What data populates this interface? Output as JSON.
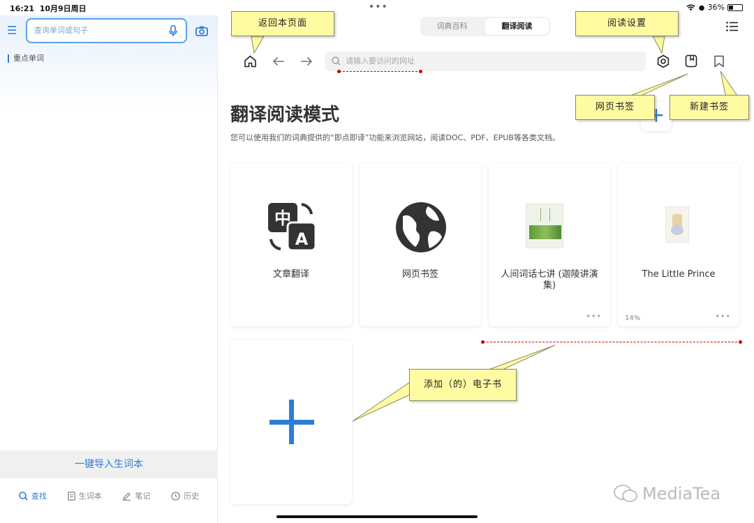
{
  "status": {
    "time": "16:21",
    "date": "10月9日周日",
    "battery": "36%",
    "battery_level": 0.36
  },
  "left": {
    "search_placeholder": "查询单词或句子",
    "section_label": "重点单词",
    "import_label": "一键导入生词本",
    "tabs": [
      {
        "label": "查找",
        "icon": "search-icon",
        "active": true
      },
      {
        "label": "生词本",
        "icon": "notebook-icon",
        "active": false
      },
      {
        "label": "笔记",
        "icon": "pen-icon",
        "active": false
      },
      {
        "label": "历史",
        "icon": "clock-icon",
        "active": false
      }
    ]
  },
  "segment": {
    "options": [
      "词典百科",
      "翻译阅读"
    ],
    "active": 1
  },
  "toolbar": {
    "url_placeholder": "请输入要访问的网址"
  },
  "main": {
    "title": "翻译阅读模式",
    "subtitle": "您可以使用我们的词典提供的“即点即译”功能来浏览网站，阅读DOC、PDF、EPUB等各类文档。",
    "add_symbol": "+",
    "cards": [
      {
        "label": "文章翻译",
        "icon": "translate-icon"
      },
      {
        "label": "网页书签",
        "icon": "globe-icon"
      },
      {
        "label": "人间词话七讲 (迦陵讲演集)",
        "icon": "book-cover",
        "more": "•••"
      },
      {
        "label": "The Little Prince",
        "icon": "book-cover",
        "progress": "14%",
        "more": "•••"
      }
    ]
  },
  "annotations": {
    "home": "返回本页面",
    "reading_settings": "阅读设置",
    "web_bookmark": "网页书签",
    "new_bookmark": "新建书签",
    "add_ebook": "添加（的）电子书"
  },
  "watermark": "MediaTea",
  "colors": {
    "accent": "#2e7cd6",
    "callout": "#fefba2",
    "dash": "#cc0000"
  }
}
